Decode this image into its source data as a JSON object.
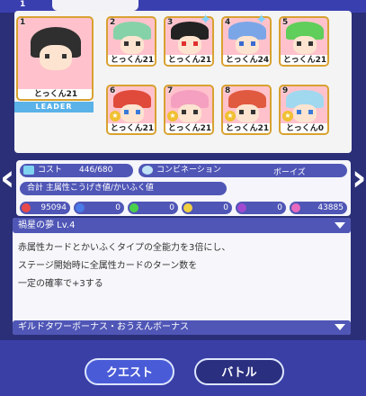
{
  "header": {
    "slot_number": "1"
  },
  "cards": [
    {
      "slot": "1",
      "label": "とっくん21",
      "hair": "#3a3a3a",
      "frame": "#ffb9c4",
      "leader": true
    },
    {
      "slot": "2",
      "label": "とっくん21",
      "hair": "#86d2a8",
      "frame": "#ffb9c4"
    },
    {
      "slot": "3",
      "label": "とっくん21",
      "hair": "#222222",
      "frame": "#ffb9c4"
    },
    {
      "slot": "4",
      "label": "とっくん24",
      "hair": "#7aa6e8",
      "frame": "#ffb9c4"
    },
    {
      "slot": "5",
      "label": "とっくん21",
      "hair": "#5fce5a",
      "frame": "#ffb9c4"
    },
    {
      "slot": "6",
      "label": "とっくん21",
      "hair": "#e04a3a",
      "frame": "#ffb9c4"
    },
    {
      "slot": "7",
      "label": "とっくん21",
      "hair": "#f5a0c0",
      "frame": "#ffb9c4"
    },
    {
      "slot": "8",
      "label": "とっくん21",
      "hair": "#e05a40",
      "frame": "#ffb9c4"
    },
    {
      "slot": "9",
      "label": "とっくん0",
      "hair": "#a0d8f0",
      "frame": "#ffb9c4"
    }
  ],
  "leader_label": "LEADER",
  "stats": {
    "cost_label": "コスト",
    "cost_value": "446/680",
    "combination_label": "コンビネーション",
    "combination_value": "ボーイズ",
    "total_label": "合計 主属性こうげき値/かいふく値"
  },
  "color_values": [
    {
      "color": "#e84a4a",
      "value": "95094"
    },
    {
      "color": "#4a7ae8",
      "value": "0"
    },
    {
      "color": "#4ad04a",
      "value": "0"
    },
    {
      "color": "#f0d040",
      "value": "0"
    },
    {
      "color": "#a04ad0",
      "value": "0"
    },
    {
      "color": "#e86ac0",
      "value": "43885"
    }
  ],
  "skill": {
    "title": "禍星の夢 Lv.4",
    "lines": [
      "赤属性カードとかいふくタイプの全能力を3倍にし、",
      "ステージ開始時に全属性カードのターン数を",
      "一定の確率で+3する"
    ]
  },
  "bonus_header": "ギルドタワーボーナス・おうえんボーナス",
  "buttons": {
    "quest": "クエスト",
    "battle": "バトル"
  },
  "icons": {
    "left_arrow": "chevron-left-icon",
    "right_arrow": "chevron-right-icon"
  }
}
